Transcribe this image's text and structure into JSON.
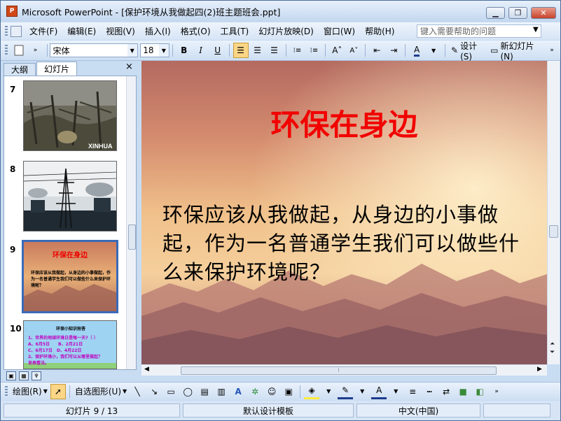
{
  "window": {
    "title": "Microsoft PowerPoint - [保护环境从我做起四(2)班主题班会.ppt]",
    "icon_label": "P",
    "buttons": [
      "minimize",
      "restore",
      "close"
    ]
  },
  "menu": {
    "items": [
      "文件(F)",
      "编辑(E)",
      "视图(V)",
      "插入(I)",
      "格式(O)",
      "工具(T)",
      "幻灯片放映(D)",
      "窗口(W)",
      "帮助(H)"
    ],
    "help_placeholder": "键入需要帮助的问题"
  },
  "toolbar": {
    "font_name": "宋体",
    "font_size": "18",
    "bold": "B",
    "italic": "I",
    "underline": "U",
    "design_label": "设计(S)",
    "new_slide_label": "新幻灯片(N)"
  },
  "pane": {
    "tabs": [
      "大纲",
      "幻灯片"
    ],
    "active_tab": "幻灯片",
    "close": "×"
  },
  "thumbnails": [
    {
      "number": "7",
      "kind": "photo",
      "caption": "XINHUA"
    },
    {
      "number": "8",
      "kind": "photo",
      "caption": ""
    },
    {
      "number": "9",
      "kind": "slide",
      "title": "环保在身边",
      "body": "环保应该从我做起，从身边的小事做起，作为一名普通学生我们可以做些什么来保护环境呢？",
      "selected": true
    },
    {
      "number": "10",
      "kind": "quiz",
      "title": "环保小知识抢答",
      "lines": [
        "1、世界的地球环境日是每一天?（ ）",
        "A、6月5日　　B、2月21日",
        "C、6月17日　D、4月22日",
        "2、保护环境小，我们可以从哪里做起？",
        "发表看法。"
      ]
    }
  ],
  "slide": {
    "title": "环保在身边",
    "body": "环保应该从我做起，从身边的小事做起，作为一名普通学生我们可以做些什么来保护环境呢？",
    "colors": {
      "title": "#f20000",
      "body": "#000000"
    }
  },
  "drawing_toolbar": {
    "draw_label": "绘图(R)",
    "autoshape_label": "自选图形(U)"
  },
  "status": {
    "slide_counter": "幻灯片 9 / 13",
    "template": "默认设计模板",
    "language": "中文(中国)"
  }
}
